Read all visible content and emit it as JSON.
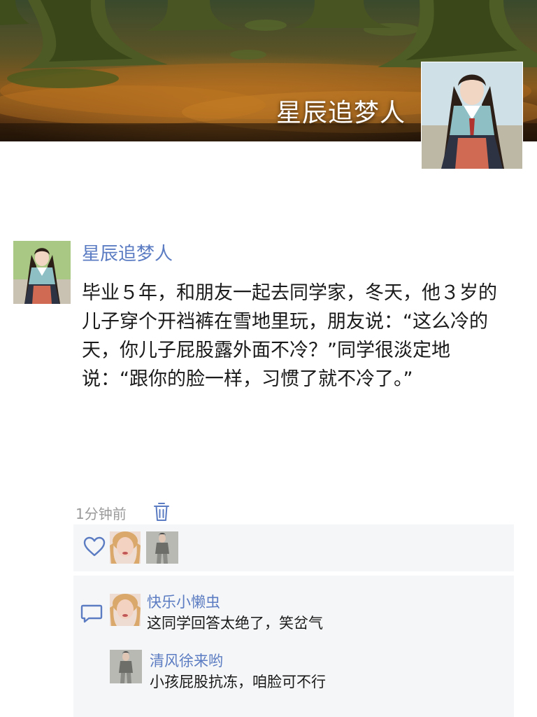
{
  "cover": {
    "title": "星辰追梦人"
  },
  "post": {
    "author": "星辰追梦人",
    "content": "毕业５年，和朋友一起去同学家，冬天，他３岁的儿子穿个开裆裤在雪地里玩，朋友说：“这么冷的天，你儿子屁股露外面不冷？”同学很淡定地说：“跟你的脸一样，习惯了就不冷了。”",
    "time": "1分钟前"
  },
  "likes": {
    "icon": "heart-icon"
  },
  "comments": [
    {
      "author": "快乐小懒虫",
      "text": "这同学回答太绝了，笑岔气"
    },
    {
      "author": "清风徐来哟",
      "text": "小孩屁股抗冻，咱脸可不行"
    }
  ],
  "colors": {
    "link": "#5b7cc2",
    "panel": "#f5f6f7",
    "meta": "#9a9a9a"
  }
}
